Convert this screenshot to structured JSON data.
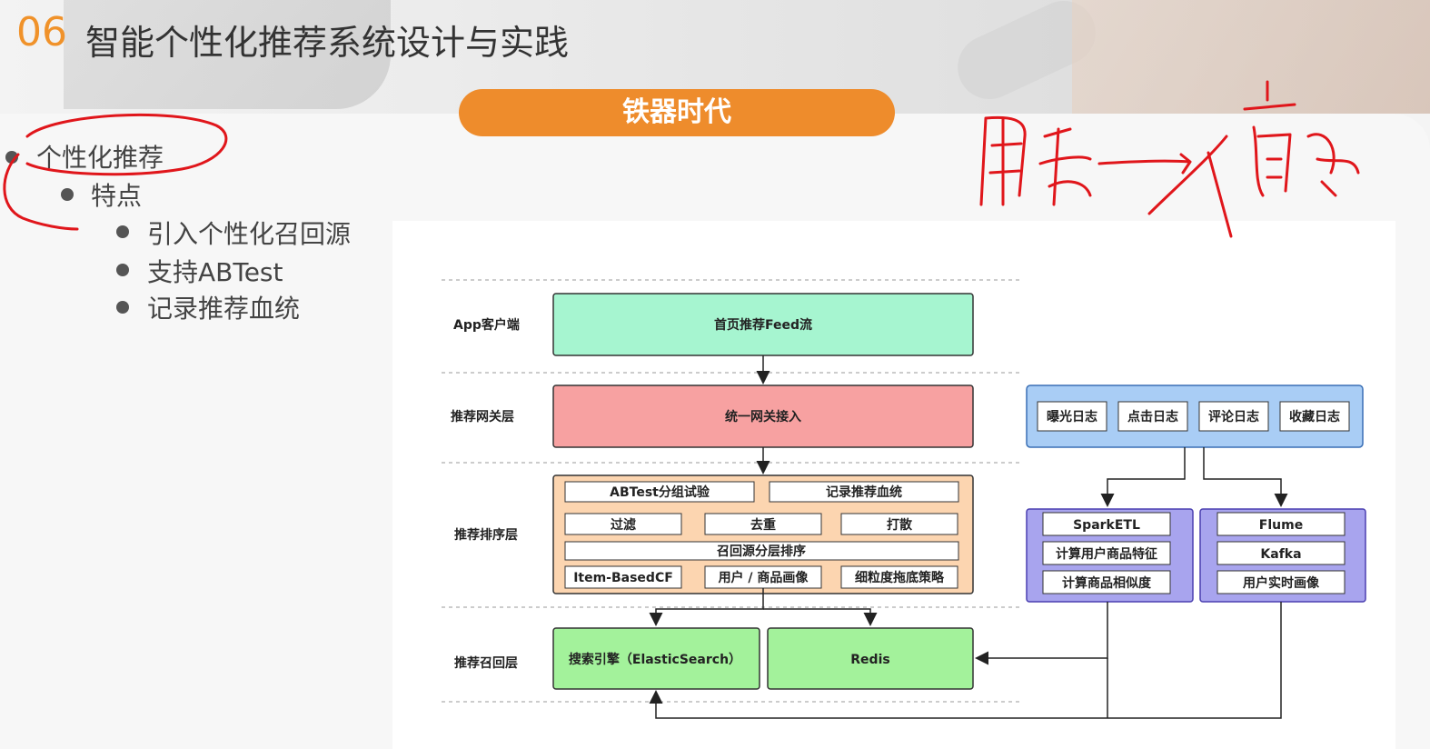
{
  "slide": {
    "number": "06",
    "title": "智能个性化推荐系统设计与实践",
    "era": "铁器时代"
  },
  "bullets": {
    "level1": "个性化推荐",
    "level2": "特点",
    "level3": [
      "引入个性化召回源",
      "支持ABTest",
      "记录推荐血统"
    ]
  },
  "diagram": {
    "layers": [
      "App客户端",
      "推荐网关层",
      "推荐排序层",
      "推荐召回层"
    ],
    "app_box": "首页推荐Feed流",
    "gateway_box": "统一网关接入",
    "rank_boxes": {
      "row1": [
        "ABTest分组试验",
        "记录推荐血统"
      ],
      "row2": [
        "过滤",
        "去重",
        "打散"
      ],
      "row3": "召回源分层排序",
      "row4": [
        "Item-BasedCF",
        "用户 / 商品画像",
        "细粒度拖底策略"
      ]
    },
    "recall_boxes": [
      "搜索引擎（ElasticSearch）",
      "Redis"
    ],
    "logs": [
      "曝光日志",
      "点击日志",
      "评论日志",
      "收藏日志"
    ],
    "spark_group": [
      "SparkETL",
      "计算用户商品特征",
      "计算商品相似度"
    ],
    "flume_group": [
      "Flume",
      "Kafka",
      "用户实时画像"
    ]
  },
  "annotation": {
    "handwritten_note": "用户—>商品"
  },
  "colors": {
    "accent": "#ee8c2c",
    "app_box": "#a6f5d0",
    "gateway_box": "#f7a1a1",
    "rank_group": "#fcd5b0",
    "recall_box": "#a3f29b",
    "log_group": "#a9cdf5",
    "compute_group": "#a8a4ee",
    "ink": "#e0161b"
  }
}
